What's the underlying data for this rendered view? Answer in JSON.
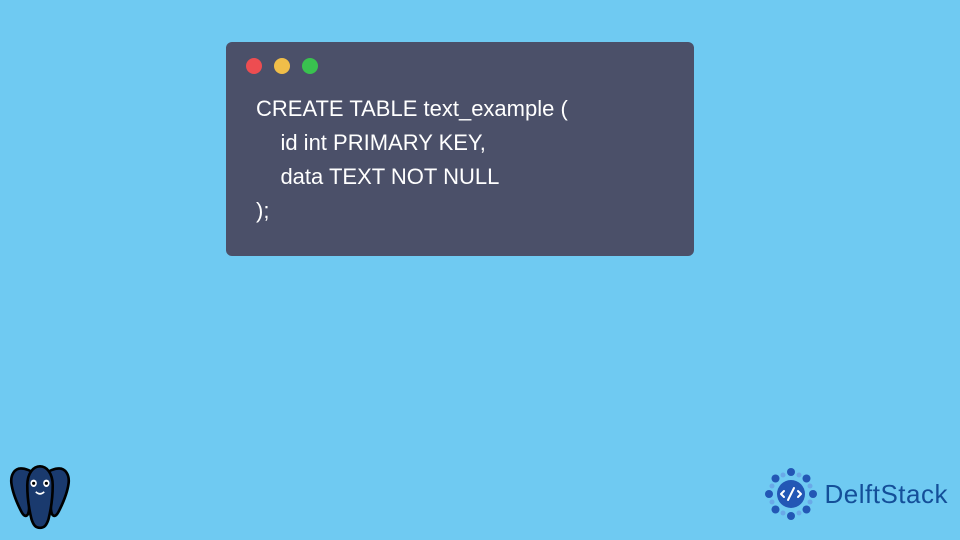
{
  "code": {
    "line1": "CREATE TABLE text_example (",
    "line2": "    id int PRIMARY KEY,",
    "line3": "    data TEXT NOT NULL",
    "line4": ");"
  },
  "brand": {
    "name": "DelftStack"
  },
  "colors": {
    "background": "#6fcaf2",
    "window": "#4b5069",
    "dotRed": "#ed4d51",
    "dotYellow": "#f0be49",
    "dotGreen": "#39c24f",
    "brandText": "#144f99"
  }
}
